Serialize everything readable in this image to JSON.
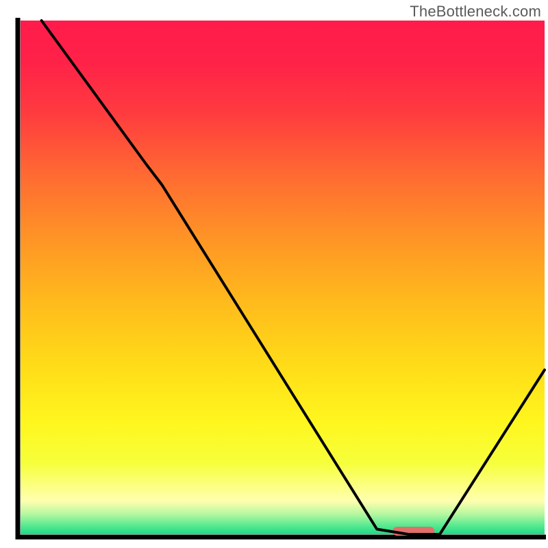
{
  "watermark": "TheBottleneck.com",
  "chart_data": {
    "type": "line",
    "title": "",
    "xlabel": "",
    "ylabel": "",
    "xlim": [
      0,
      100
    ],
    "ylim": [
      0,
      100
    ],
    "series": [
      {
        "name": "curve",
        "x": [
          4,
          24,
          27,
          68,
          74,
          80,
          100
        ],
        "y": [
          100,
          72,
          68,
          1,
          0,
          0,
          32
        ]
      }
    ],
    "marker": {
      "name": "highlight-bar",
      "x_from": 71,
      "x_to": 79,
      "y": 0,
      "color": "#e26f6a"
    },
    "gradient_stops": [
      {
        "offset": 0.0,
        "color": "#ff1b4b"
      },
      {
        "offset": 0.08,
        "color": "#ff2248"
      },
      {
        "offset": 0.18,
        "color": "#ff3b3f"
      },
      {
        "offset": 0.3,
        "color": "#ff6a32"
      },
      {
        "offset": 0.42,
        "color": "#ff9326"
      },
      {
        "offset": 0.55,
        "color": "#ffbb1c"
      },
      {
        "offset": 0.68,
        "color": "#ffde18"
      },
      {
        "offset": 0.78,
        "color": "#fff61e"
      },
      {
        "offset": 0.86,
        "color": "#f6ff3a"
      },
      {
        "offset": 0.935,
        "color": "#ffffb0"
      },
      {
        "offset": 0.96,
        "color": "#b8f8a0"
      },
      {
        "offset": 0.985,
        "color": "#4fe890"
      },
      {
        "offset": 1.0,
        "color": "#1fd884"
      }
    ],
    "axis_color": "#000000",
    "curve_color": "#000000"
  }
}
